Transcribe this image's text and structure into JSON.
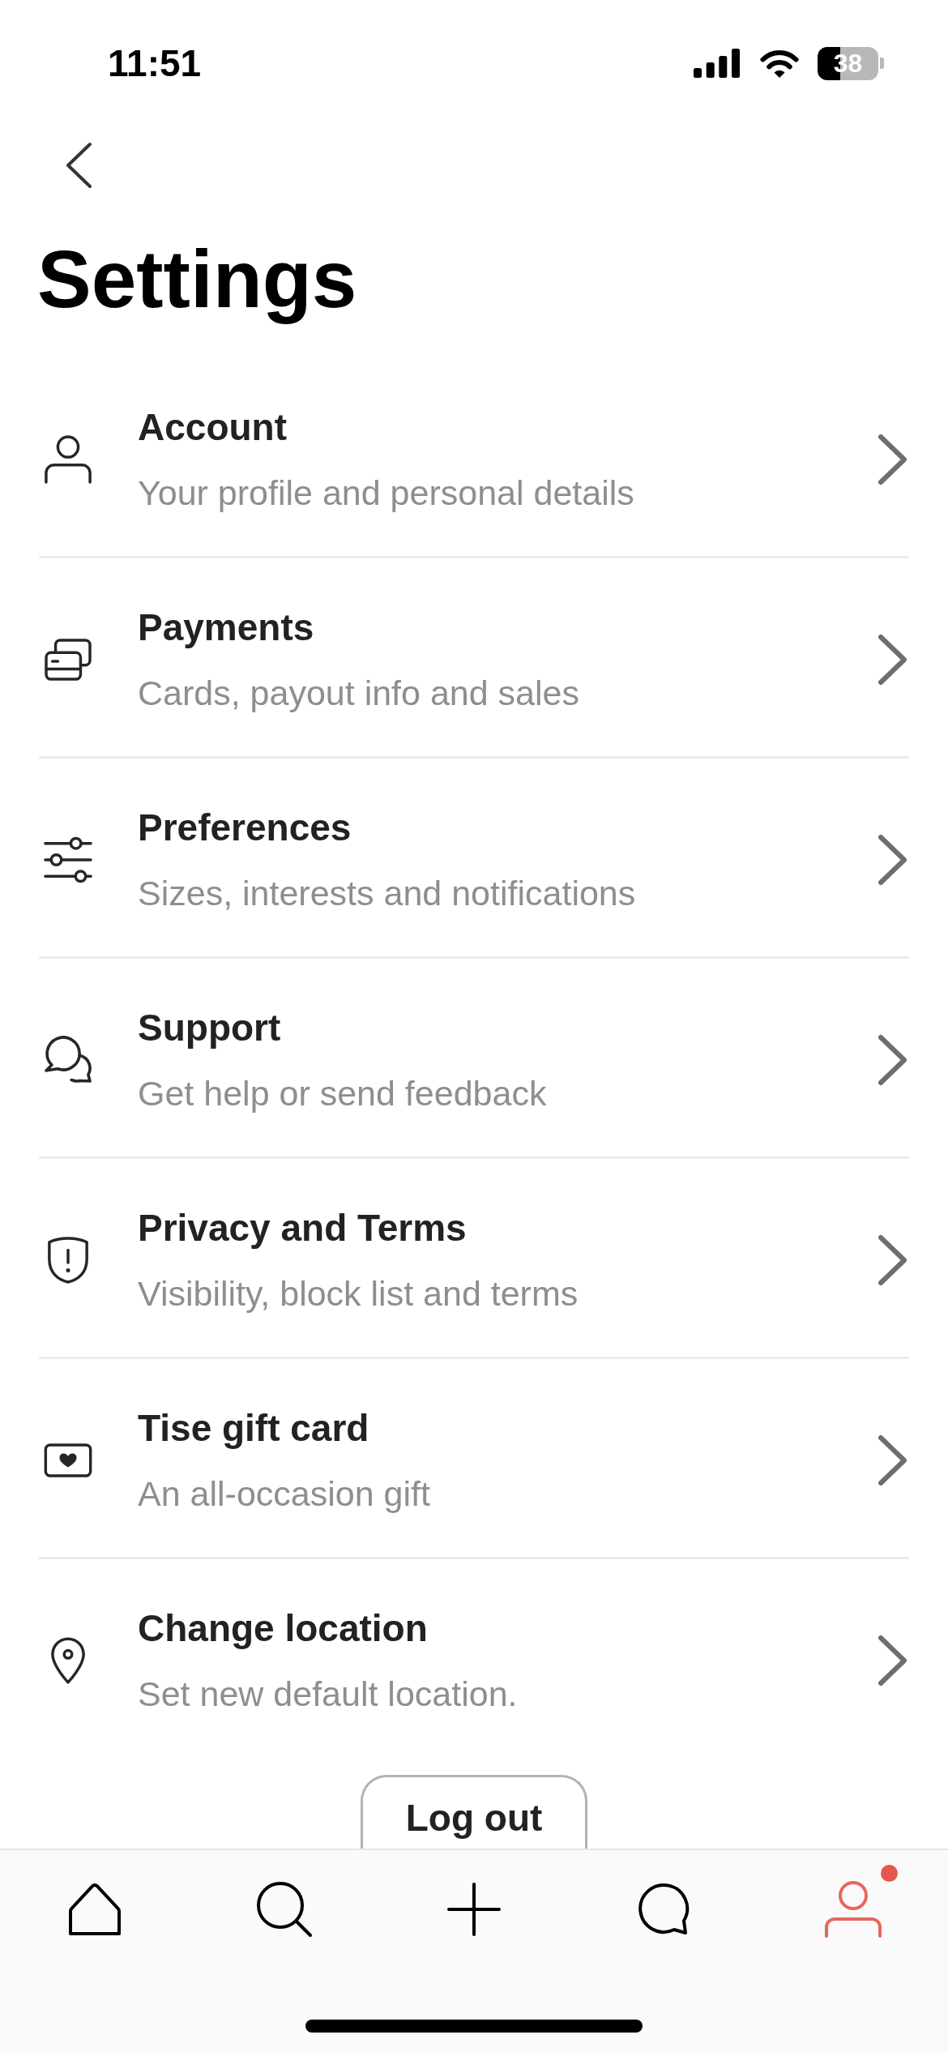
{
  "status_bar": {
    "time": "11:51",
    "battery": "38"
  },
  "header": {
    "title": "Settings"
  },
  "settings": [
    {
      "title": "Account",
      "subtitle": "Your profile and personal details"
    },
    {
      "title": "Payments",
      "subtitle": "Cards, payout info and sales"
    },
    {
      "title": "Preferences",
      "subtitle": "Sizes, interests and notifications"
    },
    {
      "title": "Support",
      "subtitle": "Get help or send feedback"
    },
    {
      "title": "Privacy and Terms",
      "subtitle": "Visibility, block list and terms"
    },
    {
      "title": "Tise gift card",
      "subtitle": "An all-occasion gift"
    },
    {
      "title": "Change location",
      "subtitle": "Set new default location."
    }
  ],
  "logout_button": {
    "label": "Log out"
  },
  "tab_bar": [
    {
      "selected": false,
      "dot": false
    },
    {
      "selected": false,
      "dot": false
    },
    {
      "selected": false,
      "dot": false
    },
    {
      "selected": false,
      "dot": false
    },
    {
      "selected": true,
      "dot": true
    }
  ]
}
